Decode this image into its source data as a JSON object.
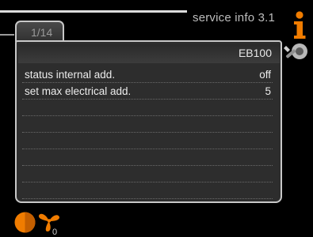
{
  "header": {
    "title": "service info 3.1",
    "tab_label": "1/14"
  },
  "panel": {
    "header": "EB100",
    "rows": [
      {
        "label": "status internal add.",
        "value": "off"
      },
      {
        "label": "set max electrical add.",
        "value": "5"
      },
      {
        "label": "",
        "value": ""
      },
      {
        "label": "",
        "value": ""
      },
      {
        "label": "",
        "value": ""
      },
      {
        "label": "",
        "value": ""
      },
      {
        "label": "",
        "value": ""
      },
      {
        "label": "",
        "value": ""
      },
      {
        "label": "",
        "value": ""
      },
      {
        "label": "",
        "value": ""
      }
    ]
  },
  "side_icons": {
    "info": "info-icon",
    "tools": "tools-icon"
  },
  "status_bar": {
    "heat_icon": "heat-icon",
    "fan_icon": "fan-icon",
    "fan_value": "0"
  },
  "colors": {
    "accent": "#f07c00",
    "panel_bg": "#2d2d2d",
    "border": "#c8c8c8"
  }
}
